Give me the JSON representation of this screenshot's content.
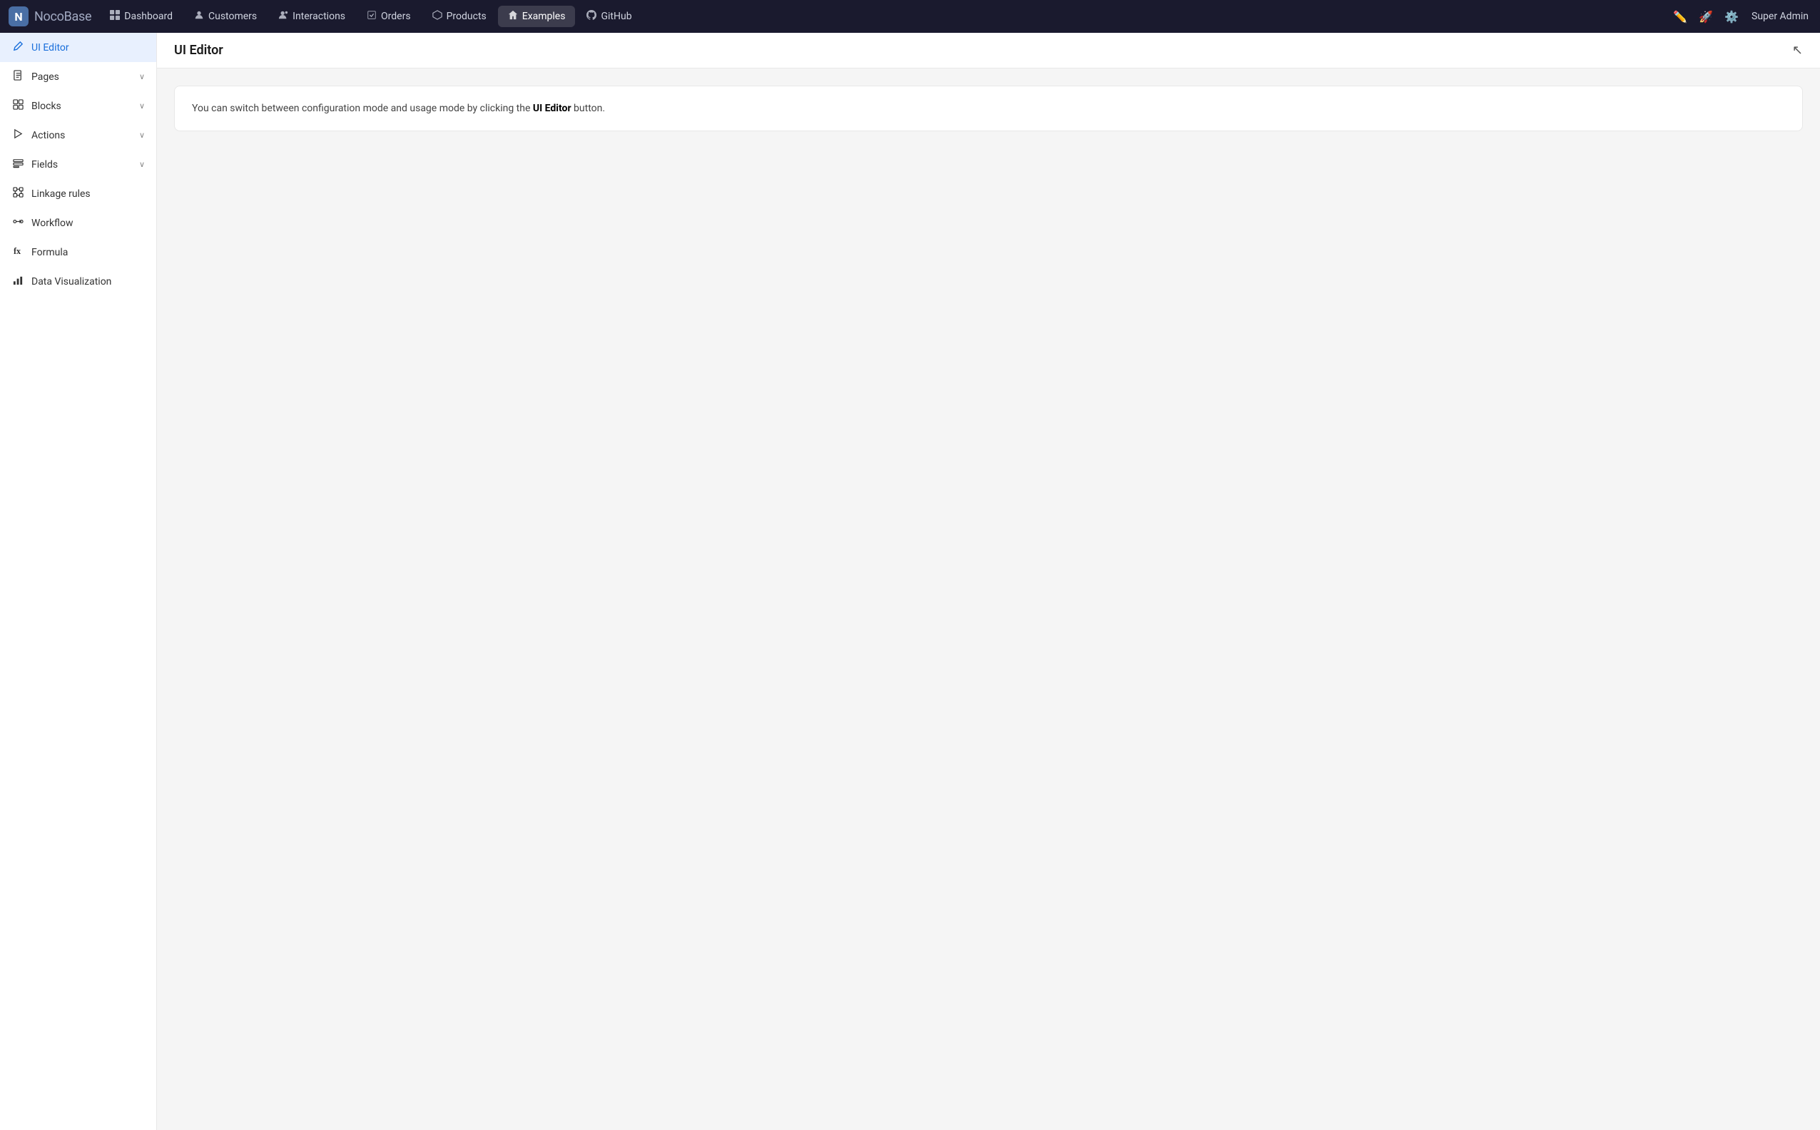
{
  "app": {
    "logo_text_bold": "Noco",
    "logo_text_light": "Base"
  },
  "topnav": {
    "items": [
      {
        "label": "Dashboard",
        "icon": "📊",
        "active": false,
        "name": "dashboard"
      },
      {
        "label": "Customers",
        "icon": "👥",
        "active": false,
        "name": "customers"
      },
      {
        "label": "Interactions",
        "icon": "👤",
        "active": false,
        "name": "interactions"
      },
      {
        "label": "Orders",
        "icon": "🛒",
        "active": false,
        "name": "orders"
      },
      {
        "label": "Products",
        "icon": "🏷️",
        "active": false,
        "name": "products"
      },
      {
        "label": "Examples",
        "icon": "🏠",
        "active": true,
        "name": "examples"
      },
      {
        "label": "GitHub",
        "icon": "⚙️",
        "active": false,
        "name": "github"
      }
    ],
    "user": "Super Admin"
  },
  "sidebar": {
    "items": [
      {
        "label": "UI Editor",
        "icon": "✏️",
        "active": true,
        "has_chevron": false,
        "name": "ui-editor"
      },
      {
        "label": "Pages",
        "icon": "📄",
        "active": false,
        "has_chevron": true,
        "name": "pages"
      },
      {
        "label": "Blocks",
        "icon": "⬛",
        "active": false,
        "has_chevron": true,
        "name": "blocks"
      },
      {
        "label": "Actions",
        "icon": "⚡",
        "active": false,
        "has_chevron": true,
        "name": "actions"
      },
      {
        "label": "Fields",
        "icon": "📋",
        "active": false,
        "has_chevron": true,
        "name": "fields"
      },
      {
        "label": "Linkage rules",
        "icon": "🔗",
        "active": false,
        "has_chevron": false,
        "name": "linkage-rules"
      },
      {
        "label": "Workflow",
        "icon": "↔️",
        "active": false,
        "has_chevron": false,
        "name": "workflow"
      },
      {
        "label": "Formula",
        "icon": "fx",
        "active": false,
        "has_chevron": false,
        "name": "formula"
      },
      {
        "label": "Data Visualization",
        "icon": "📊",
        "active": false,
        "has_chevron": false,
        "name": "data-visualization"
      }
    ]
  },
  "content": {
    "title": "UI Editor",
    "info_text_before": "You can switch between configuration mode and usage mode by clicking the ",
    "info_text_bold": "UI Editor",
    "info_text_after": " button."
  }
}
